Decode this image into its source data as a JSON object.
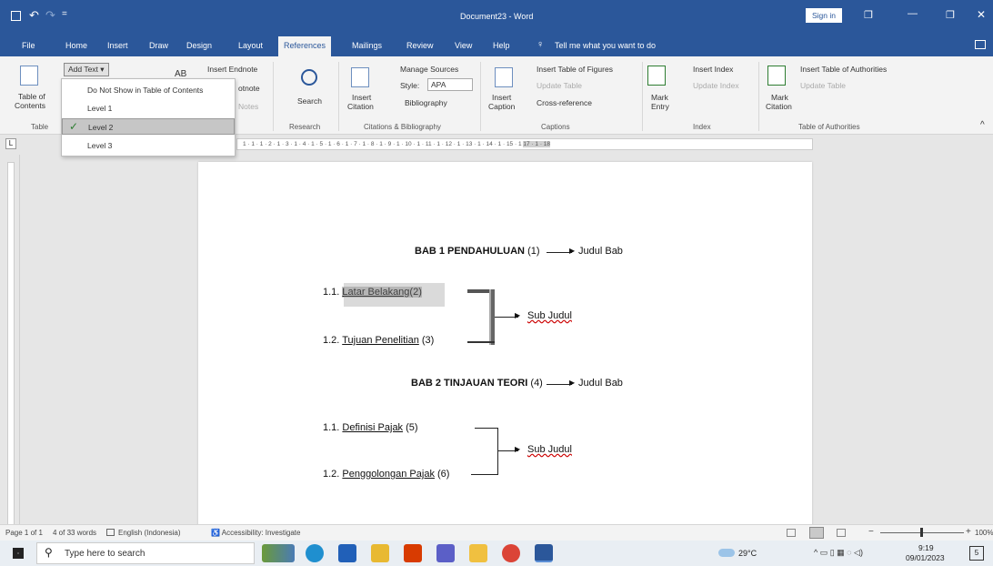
{
  "window": {
    "title": "Document23 - Word",
    "sign_in": "Sign in",
    "min": "—",
    "max": "❐",
    "close": "✕"
  },
  "quick_access": {
    "save_icon": "save-icon",
    "undo": "↶",
    "redo": "↷",
    "more": "="
  },
  "menu": [
    "File",
    "Home",
    "Insert",
    "Draw",
    "Design",
    "Layout",
    "References",
    "Mailings",
    "Review",
    "View",
    "Help"
  ],
  "tell_me": "Tell me what you want to do",
  "ribbon": {
    "toc": {
      "label1": "Table of",
      "label2": "Contents",
      "add_text": "Add Text",
      "group": "Table"
    },
    "footnotes": {
      "insert_endnote": "Insert Endnote",
      "next_footnote": "otnote",
      "notes": "Notes",
      "ab": "AB"
    },
    "research": {
      "search": "Search",
      "group": "Research"
    },
    "citations": {
      "insert": "Insert",
      "citation": "Citation",
      "manage": "Manage Sources",
      "style_label": "Style:",
      "style_value": "APA",
      "bibliography": "Bibliography",
      "group": "Citations & Bibliography"
    },
    "captions": {
      "insert": "Insert",
      "caption": "Caption",
      "table_figures": "Insert Table of Figures",
      "update_table": "Update Table",
      "cross_ref": "Cross-reference",
      "group": "Captions"
    },
    "index": {
      "mark": "Mark",
      "entry": "Entry",
      "insert_index": "Insert Index",
      "update_index": "Update Index",
      "group": "Index"
    },
    "toa": {
      "mark": "Mark",
      "citation": "Citation",
      "insert": "Insert Table of Authorities",
      "update": "Update Table",
      "group": "Table of Authorities"
    }
  },
  "dropdown": {
    "items": [
      "Do Not Show in Table of Contents",
      "Level 1",
      "Level 2",
      "Level 3"
    ],
    "selected": "Level 2",
    "check": "✓"
  },
  "document": {
    "bab1": {
      "text": "BAB 1 PENDAHULUAN",
      "num": "(1)",
      "note": "Judul Bab"
    },
    "s11": {
      "num": "1.1.",
      "text": "Latar Belakang",
      "idx": "(2)"
    },
    "s12": {
      "num": "1.2.",
      "text": "Tujuan Penelitian",
      "idx": "(3)"
    },
    "sub1": "Sub Judul",
    "bab2": {
      "text": "BAB 2 TINJAUAN TEORI",
      "num": "(4)",
      "note": "Judul Bab"
    },
    "s21": {
      "num": "1.1.",
      "text": "Definisi Pajak",
      "idx": "(5)"
    },
    "s22": {
      "num": "1.2.",
      "text": "Penggolongan Pajak",
      "idx": "(6)"
    },
    "sub2": "Sub Judul"
  },
  "ruler": {
    "numbers": "1 · 1 · 1 · 2 · 1 · 3 · 1 · 4 · 1 · 5 · 1 · 6 · 1 · 7 · 1 · 8 · 1 · 9 · 1 · 10 · 1 · 11 · 1 · 12 · 1 · 13 · 1 · 14 · 1 · 15 · 1",
    "tail": "17 · 1 · 18",
    "l": "L"
  },
  "status": {
    "page": "Page 1 of 1",
    "words": "4 of 33 words",
    "language": "English (Indonesia)",
    "accessibility": "Accessibility: Investigate",
    "zoom": "100%"
  },
  "taskbar": {
    "search": "Type here to search",
    "temp": "29°C",
    "time": "9:19",
    "date": "09/01/2023",
    "notif": "5"
  },
  "colors": {
    "word_blue": "#2b579a",
    "accent": "#2b579a"
  }
}
